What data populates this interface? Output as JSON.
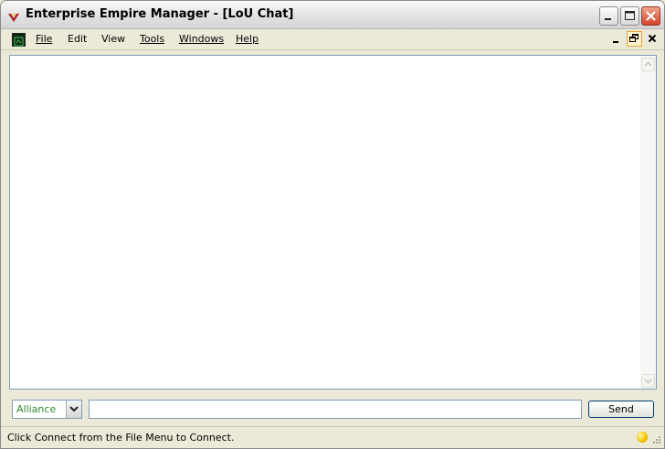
{
  "window": {
    "title": "Enterprise Empire Manager - [LoU Chat]"
  },
  "menu": {
    "items": [
      {
        "label": "File"
      },
      {
        "label": "Edit"
      },
      {
        "label": "View"
      },
      {
        "label": "Tools"
      },
      {
        "label": "Windows"
      },
      {
        "label": "Help"
      }
    ]
  },
  "chat": {
    "channel": "Alliance",
    "message": "",
    "send_label": "Send"
  },
  "status": {
    "text": "Click Connect from the File Menu to Connect."
  },
  "colors": {
    "channel_text": "#2e8b2e",
    "status_light": "#f5c400"
  }
}
